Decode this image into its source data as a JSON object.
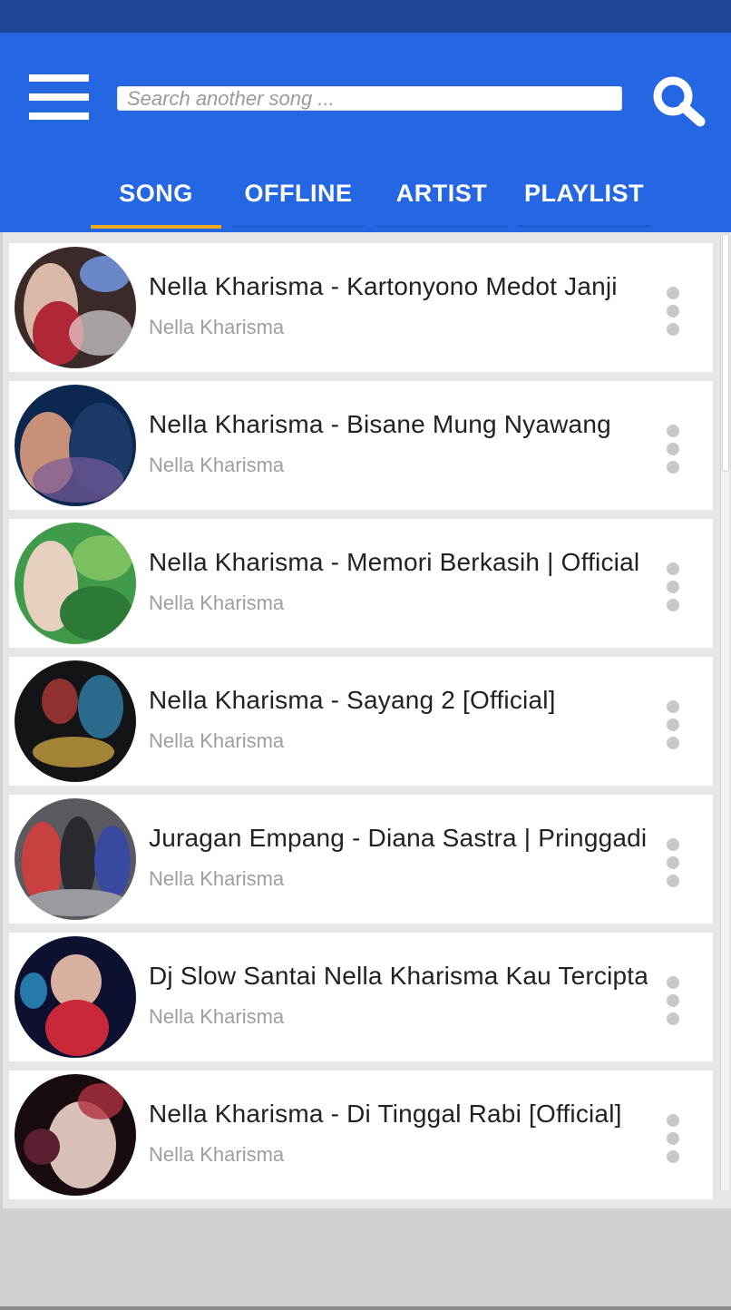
{
  "search": {
    "placeholder": "Search another song ..."
  },
  "tabs": [
    {
      "label": "SONG",
      "active": true
    },
    {
      "label": "OFFLINE",
      "active": false
    },
    {
      "label": "ARTIST",
      "active": false
    },
    {
      "label": "PLAYLIST",
      "active": false
    }
  ],
  "songs": [
    {
      "title": "Nella Kharisma - Kartonyono Medot Janji",
      "artist": "Nella Kharisma"
    },
    {
      "title": "Nella Kharisma - Bisane Mung Nyawang",
      "artist": "Nella Kharisma"
    },
    {
      "title": "Nella Kharisma - Memori Berkasih   |   Official",
      "artist": "Nella Kharisma"
    },
    {
      "title": "Nella Kharisma - Sayang 2 [Official]",
      "artist": "Nella Kharisma"
    },
    {
      "title": "Juragan Empang - Diana Sastra | Pringgading",
      "artist": "Nella Kharisma"
    },
    {
      "title": "Dj Slow Santai Nella Kharisma Kau Tercipta",
      "artist": "Nella Kharisma"
    },
    {
      "title": "Nella Kharisma - Di Tinggal Rabi [Official]",
      "artist": "Nella Kharisma"
    }
  ],
  "icons": {
    "menu": "hamburger-menu-icon",
    "search": "search-icon",
    "more": "more-vertical-icon"
  },
  "colors": {
    "status_bar": "#1d4697",
    "app_bar": "#2566e3",
    "tab_indicator": "#f0a81c",
    "title_text": "#222222",
    "artist_text": "#9e9e9e"
  }
}
